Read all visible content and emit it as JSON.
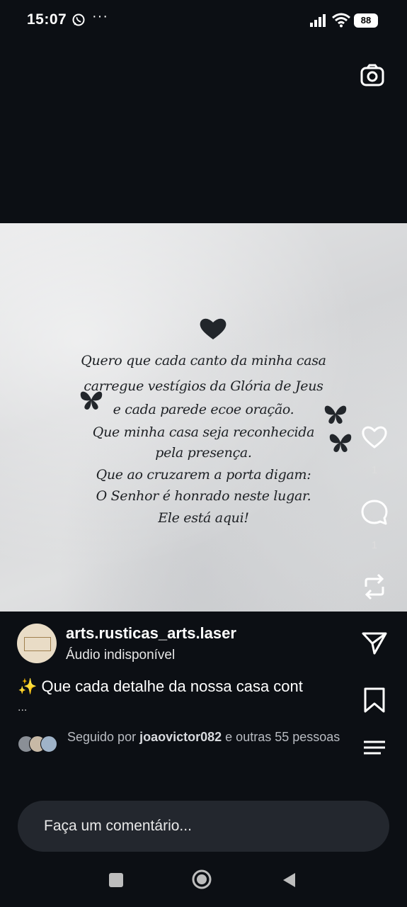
{
  "status": {
    "time": "15:07",
    "more": "···",
    "battery": "88"
  },
  "post": {
    "image_text": [
      "Quero que cada canto da minha casa",
      "carregue vestígios da Glória de Jeus",
      "e cada parede ecoe oração.",
      "Que minha casa seja reconhecida",
      "pela presença.",
      "Que ao cruzarem a porta digam:",
      "O Senhor é honrado neste lugar.",
      "Ele está aqui!"
    ],
    "likes_count": "1",
    "comments_count": "1"
  },
  "author": {
    "username": "arts.rusticas_arts.laser",
    "audio": "Áudio indisponível"
  },
  "caption": {
    "text": "✨ Que cada detalhe da nossa casa cont",
    "more": "..."
  },
  "followers": {
    "prefix": "Seguido por",
    "user": "joaovictor082",
    "suffix": "e outras 55 pessoas"
  },
  "comment": {
    "placeholder": "Faça um comentário..."
  },
  "colors": {
    "background": "#0c0f14",
    "comment_box": "#23272e",
    "marble": "#dcdddf"
  }
}
